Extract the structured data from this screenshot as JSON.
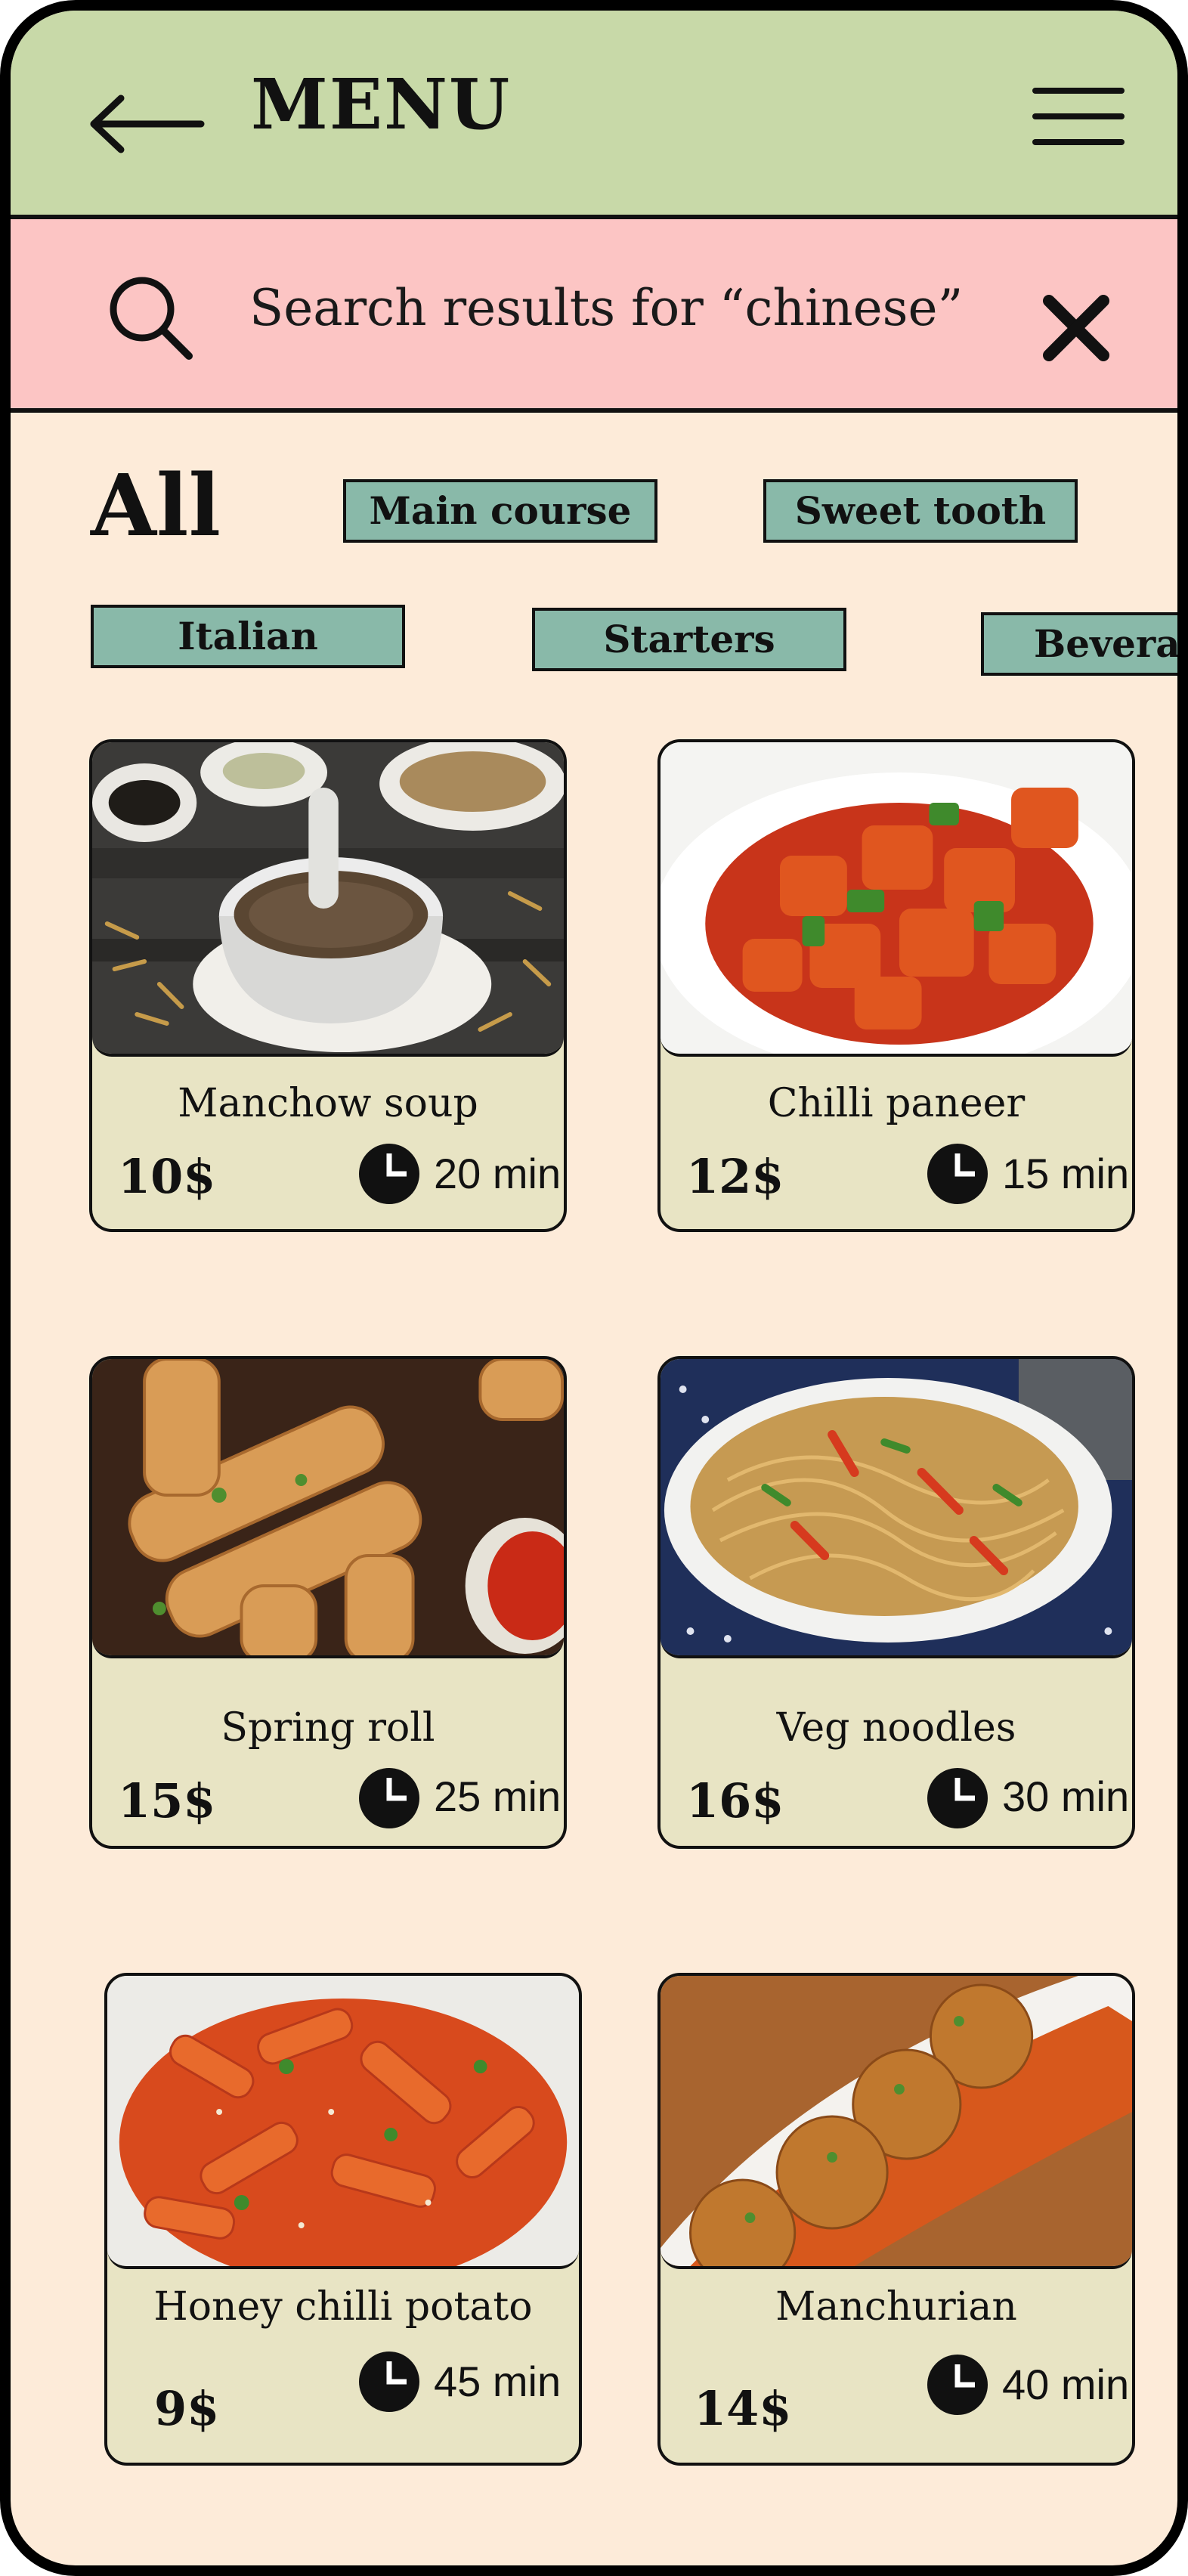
{
  "header": {
    "title": "MENU",
    "back_icon": "arrow-left-icon",
    "menu_icon": "hamburger-icon"
  },
  "search": {
    "icon": "search-icon",
    "text": "Search results for “chinese”",
    "clear_icon": "close-icon"
  },
  "categories": {
    "all": "All",
    "chips": [
      "Main course",
      "Sweet tooth",
      "Italian",
      "Starters",
      "Beverages"
    ]
  },
  "dishes": [
    {
      "name": "Manchow soup",
      "price": "10$",
      "time": "20 min",
      "icon": "clock-icon"
    },
    {
      "name": "Chilli paneer",
      "price": "12$",
      "time": "15 min",
      "icon": "clock-icon"
    },
    {
      "name": "Spring roll",
      "price": "15$",
      "time": "25 min",
      "icon": "clock-icon"
    },
    {
      "name": "Veg noodles",
      "price": "16$",
      "time": "30 min",
      "icon": "clock-icon"
    },
    {
      "name": "Honey chilli potato",
      "price": "9$",
      "time": "45 min",
      "icon": "clock-icon"
    },
    {
      "name": "Manchurian",
      "price": "14$",
      "time": "40 min",
      "icon": "clock-icon"
    }
  ],
  "colors": {
    "header_bg": "#c8d9a8",
    "search_bg": "#fcc5c4",
    "page_bg": "#fdebd9",
    "chip_bg": "#89b9a9",
    "card_bg": "#e8e4c4"
  }
}
